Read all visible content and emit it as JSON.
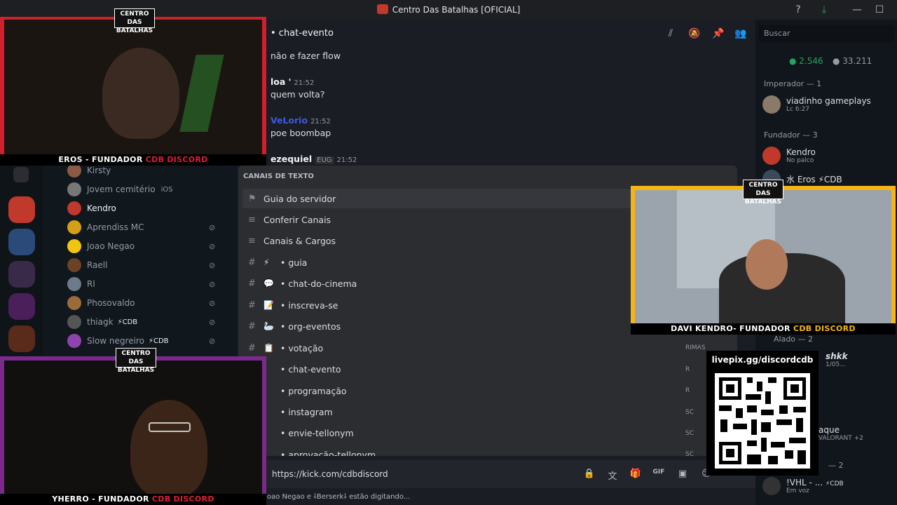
{
  "window": {
    "title": "Centro Das Batalhas [OFICIAL]"
  },
  "chat": {
    "channel": "• chat-evento",
    "messages": [
      {
        "author": "",
        "text": "não e fazer flow"
      },
      {
        "author": "loa '",
        "time": "21:52",
        "text": "quem volta?"
      },
      {
        "author": "VeLorio",
        "time": "21:52",
        "text": "poe boombap"
      },
      {
        "author": "ezequiel",
        "tag": "EUG",
        "time": "21:52",
        "text": ""
      }
    ],
    "composer_value": "https://kick.com/cdbdiscord",
    "typing": "Joao Negao e ⸸Berserk⸸ estão digitando..."
  },
  "popup": {
    "heading": "CANAIS DE TEXTO",
    "items": [
      {
        "label": "Guia do servidor",
        "glyph": "⚑",
        "emoji": ""
      },
      {
        "label": "Conferir Canais",
        "glyph": "≡",
        "emoji": ""
      },
      {
        "label": "Canais & Cargos",
        "glyph": "≡",
        "emoji": ""
      },
      {
        "label": "• guia",
        "glyph": "#",
        "emoji": "⚡"
      },
      {
        "label": "• chat-do-cinema",
        "glyph": "#",
        "emoji": "💬"
      },
      {
        "label": "• inscreva-se",
        "glyph": "#",
        "emoji": "📝"
      },
      {
        "label": "• org-eventos",
        "glyph": "#",
        "emoji": "🦢"
      },
      {
        "label": "• votação",
        "glyph": "#",
        "emoji": "📋"
      },
      {
        "label": "• chat-evento",
        "glyph": "#",
        "emoji": ""
      },
      {
        "label": "• programação",
        "glyph": "#",
        "emoji": ""
      },
      {
        "label": "• instagram",
        "glyph": "#",
        "emoji": ""
      },
      {
        "label": "• envie-tellonym",
        "glyph": "#",
        "emoji": ""
      },
      {
        "label": "• aprovação-tellonym",
        "glyph": "#",
        "emoji": ""
      }
    ],
    "tags": [
      "RIMAS",
      "R",
      "R",
      "SC",
      "SC",
      "SC"
    ]
  },
  "left_members": [
    {
      "name": "Kirsty",
      "color": "#949ba4",
      "avatar": "#8a5a44"
    },
    {
      "name": "Jovem cemitério",
      "color": "#949ba4",
      "avatar": "#777",
      "extra": "iOS"
    },
    {
      "name": "Kendro",
      "color": "#f2f3f5",
      "avatar": "#c0392b"
    },
    {
      "name": "Aprendiss MC",
      "color": "#949ba4",
      "avatar": "#d4a017"
    },
    {
      "name": "Joao Negao",
      "color": "#949ba4",
      "avatar": "#f1c40f"
    },
    {
      "name": "Raell",
      "color": "#949ba4",
      "avatar": "#6b4226"
    },
    {
      "name": "Rl",
      "color": "#949ba4",
      "avatar": "#6c7a89"
    },
    {
      "name": "Phosovaldo",
      "color": "#949ba4",
      "avatar": "#9b6b3a"
    },
    {
      "name": "thiagk",
      "color": "#949ba4",
      "avatar": "#555",
      "extra": "⚡CDB"
    },
    {
      "name": "Slow negreiro",
      "color": "#949ba4",
      "avatar": "#8e44ad",
      "extra": "⚡CDB"
    }
  ],
  "right": {
    "search_placeholder": "Buscar",
    "online": "2.546",
    "total": "33.211",
    "groups": [
      {
        "label": "Imperador — 1",
        "members": [
          {
            "name": "viadinho gameplays",
            "sub": "Lc 6:27",
            "color": "#f2f3f5"
          }
        ]
      },
      {
        "label": "Fundador — 3",
        "members": [
          {
            "name": "Kendro",
            "sub": "No palco",
            "color": "#f2f3f5"
          },
          {
            "name": "水 Eros ⚡CDB",
            "sub": "",
            "color": "#f2f3f5"
          }
        ]
      }
    ],
    "alado": "Alado — 2",
    "member_shkk": "shkk",
    "member_shkk_sub": "1/05...",
    "member_aque": "aque",
    "member_aque_sub": "VALORANT +2",
    "group_2": "— 2",
    "member_vhl": "!VHL - ...",
    "member_vhl_tag": "⚡CDB",
    "member_vhl_sub": "Em voz"
  },
  "cams": {
    "eros": {
      "name": "EROS - FUNDADOR ",
      "hl": "CDB DISCORD"
    },
    "davi": {
      "name": "DAVI KENDRO- FUNDADOR ",
      "hl": "CDB DISCORD"
    },
    "yherro": {
      "name": "YHERRO - FUNDADOR ",
      "hl": "CDB DISCORD"
    },
    "logo": "CENTRO DAS BATALHAS"
  },
  "qr": {
    "label": "livepix.gg/discordcdb"
  },
  "colors": {
    "accent_red": "#e01e37",
    "cam_red": "#d01f2d",
    "cam_yellow": "#f5b514",
    "cam_purple": "#7b2a8c",
    "online_green": "#23a55a"
  },
  "icons": [
    "threads-icon",
    "mute-notifications-icon",
    "pin-icon",
    "members-icon",
    "help-icon",
    "download-icon",
    "minimize-icon",
    "maximize-icon",
    "lock-icon",
    "translate-icon",
    "gift-icon",
    "gif-icon",
    "sticker-icon",
    "emoji-icon"
  ]
}
